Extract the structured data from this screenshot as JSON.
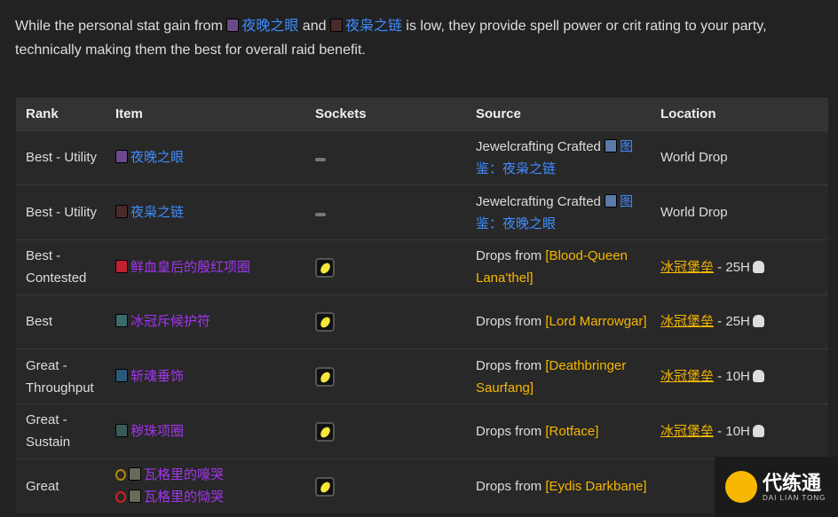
{
  "intro": {
    "before": "While the personal stat gain from ",
    "item1": "夜晚之眼",
    "mid": " and ",
    "item2": "夜枭之链",
    "after": " is low, they provide spell power or crit rating to your party, technically making them the best for overall raid benefit."
  },
  "table": {
    "headers": [
      "Rank",
      "Item",
      "Sockets",
      "Source",
      "Location"
    ],
    "rows": [
      {
        "rank": "Best - Utility",
        "items": [
          {
            "name": "夜晚之眼",
            "color": "#3f8cff",
            "icon": "#6a4a8a"
          }
        ],
        "socket": "none",
        "source_prefix": "Jewelcrafting Crafted ",
        "source_link": "图鉴：夜枭之链",
        "source_type": "craft",
        "location": "World Drop",
        "loc_suffix": ""
      },
      {
        "rank": "Best - Utility",
        "items": [
          {
            "name": "夜枭之链",
            "color": "#3f8cff",
            "icon": "#4a2a2a"
          }
        ],
        "socket": "none",
        "source_prefix": "Jewelcrafting Crafted ",
        "source_link": "图鉴：夜晚之眼",
        "source_type": "craft",
        "location": "World Drop",
        "loc_suffix": ""
      },
      {
        "rank": "Best - Contested",
        "items": [
          {
            "name": "鲜血皇后的殷红项圈",
            "color": "#a335ee",
            "icon": "#c02030"
          }
        ],
        "socket": "yellow",
        "source_prefix": "Drops from ",
        "source_link": "[Blood-Queen Lana'thel]",
        "source_type": "drop",
        "location": "冰冠堡垒",
        "loc_suffix": " - 25H"
      },
      {
        "rank": "Best",
        "items": [
          {
            "name": "冰冠斥候护符",
            "color": "#a335ee",
            "icon": "#3a6a6a"
          }
        ],
        "socket": "yellow",
        "source_prefix": "Drops from ",
        "source_link": "[Lord Marrowgar]",
        "source_type": "drop",
        "location": "冰冠堡垒",
        "loc_suffix": " - 25H"
      },
      {
        "rank": "Great - Throughput",
        "items": [
          {
            "name": "斩魂垂饰",
            "color": "#a335ee",
            "icon": "#2a5a7a"
          }
        ],
        "socket": "yellow",
        "source_prefix": "Drops from ",
        "source_link": "[Deathbringer Saurfang]",
        "source_type": "drop",
        "location": "冰冠堡垒",
        "loc_suffix": " - 10H"
      },
      {
        "rank": "Great - Sustain",
        "items": [
          {
            "name": "秽珠项圈",
            "color": "#a335ee",
            "icon": "#3a5a5a"
          }
        ],
        "socket": "yellow",
        "source_prefix": "Drops from ",
        "source_link": "[Rotface]",
        "source_type": "drop",
        "location": "冰冠堡垒",
        "loc_suffix": " - 10H"
      },
      {
        "rank": "Great",
        "items": [
          {
            "name": "瓦格里的嚎哭",
            "color": "#a335ee",
            "icon": "#6a6a5a",
            "faction": "alliance"
          },
          {
            "name": "瓦格里的恸哭",
            "color": "#a335ee",
            "icon": "#6a6a5a",
            "faction": "horde"
          }
        ],
        "socket": "yellow",
        "source_prefix": "Drops from ",
        "source_link": "[Eydis Darkbane]",
        "source_type": "drop",
        "location": "",
        "loc_suffix": ""
      }
    ]
  },
  "watermark": {
    "title": "代练通",
    "subtitle": "DAI LIAN TONG"
  },
  "colors": {
    "link_blue": "#3f8cff",
    "epic_purple": "#a335ee",
    "gold": "#f8b700",
    "background": "#222222",
    "header": "#333333"
  }
}
